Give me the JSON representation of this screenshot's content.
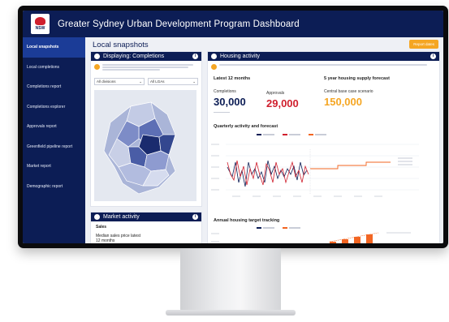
{
  "header": {
    "title": "Greater Sydney Urban Development Program Dashboard",
    "logo_text": "NSW"
  },
  "sidebar": {
    "items": [
      {
        "label": "Local snapshots",
        "active": true
      },
      {
        "label": "Local completions"
      },
      {
        "label": "Completions report"
      },
      {
        "label": "Completions explorer"
      },
      {
        "label": "Approvals report"
      },
      {
        "label": "Greenfield pipeline report"
      },
      {
        "label": "Market report"
      },
      {
        "label": "Demographic report"
      }
    ]
  },
  "main": {
    "title": "Local snapshots",
    "date_button": "Report dates"
  },
  "displaying_panel": {
    "title": "Displaying: Completions",
    "division_select": "All divisions",
    "lga_select": "All LGAs"
  },
  "market_panel": {
    "title": "Market activity",
    "subtitle": "Sales",
    "item": "Median sales price latest 12 months"
  },
  "housing_panel": {
    "title": "Housing activity",
    "latest_heading": "Latest 12 months",
    "forecast_heading": "5 year housing supply forecast",
    "completions": {
      "label": "Completions",
      "value": "30,000"
    },
    "approvals": {
      "label": "Approvals",
      "value": "29,000"
    },
    "forecast": {
      "label": "Central base case scenario",
      "value": "150,000"
    },
    "quarterly_title": "Quarterly activity and forecast",
    "annual_title": "Annual housing target tracking",
    "colors": {
      "navy": "#0c1d55",
      "red": "#d0202e",
      "orange": "#f26522",
      "accent": "#f5a623"
    }
  }
}
